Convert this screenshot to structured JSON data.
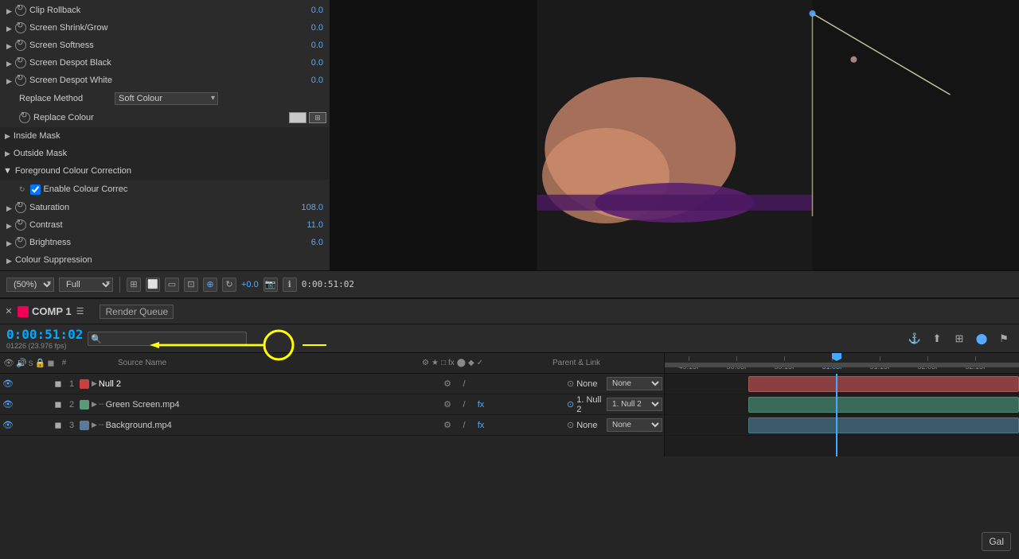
{
  "leftPanel": {
    "effects": [
      {
        "label": "Clip Rollback",
        "value": "0.0",
        "hasTriangle": true,
        "hasCycle": true
      },
      {
        "label": "Screen Shrink/Grow",
        "value": "0.0",
        "hasTriangle": true,
        "hasCycle": true
      },
      {
        "label": "Screen Softness",
        "value": "0.0",
        "hasTriangle": true,
        "hasCycle": true
      },
      {
        "label": "Screen Despot Black",
        "value": "0.0",
        "hasTriangle": true,
        "hasCycle": true
      },
      {
        "label": "Screen Despot White",
        "value": "0.0",
        "hasTriangle": true,
        "hasCycle": true
      }
    ],
    "replaceMethod": {
      "label": "Replace Method",
      "value": "Soft Colour"
    },
    "replaceColour": {
      "label": "Replace Colour"
    },
    "insideMask": "Inside Mask",
    "outsideMask": "Outside Mask",
    "foreground": {
      "label": "Foreground Colour Correction",
      "enableLabel": "Enable Colour Correc",
      "params": [
        {
          "label": "Saturation",
          "value": "108.0"
        },
        {
          "label": "Contrast",
          "value": "11.0"
        },
        {
          "label": "Brightness",
          "value": "6.0"
        }
      ],
      "colourSuppression": "Colour Suppression"
    }
  },
  "previewControls": {
    "zoom": "(50%)",
    "quality": "Full",
    "plus": "+0.0",
    "timecode": "0:00:51:02",
    "icons": [
      "grid",
      "box",
      "rect",
      "overlay",
      "color",
      "refresh",
      "camera",
      "info"
    ]
  },
  "timeline": {
    "tabs": [
      {
        "label": "COMP 1",
        "color": "#e05050"
      },
      {
        "label": "Render Queue"
      }
    ],
    "timecode": "0:00:51:02",
    "fps": "01226 (23.976 fps)",
    "searchPlaceholder": "🔍",
    "layerHeaders": {
      "icons": [
        "👁",
        "🔊",
        "S",
        "🔒",
        "◼"
      ],
      "num": "#",
      "source": "Source Name",
      "switches": [
        "⚙",
        "★",
        "□",
        "fx",
        "⬤",
        "◆",
        "✓"
      ],
      "parent": "Parent & Link"
    },
    "layers": [
      {
        "num": 1,
        "color": "#c84040",
        "hasColorBox": true,
        "name": "Null 2",
        "isNull": true,
        "visible": true,
        "switches": [
          "⚙",
          "/"
        ],
        "parentValue": "None",
        "hasParentDropdown": true
      },
      {
        "num": 2,
        "color": "#5a9a7a",
        "hasColorBox": true,
        "name": "Green Screen.mp4",
        "visible": true,
        "switches": [
          "⚙",
          "/",
          "fx"
        ],
        "parentValue": "1. Null 2",
        "hasParentDropdown": true
      },
      {
        "num": 3,
        "color": "#5a7a9a",
        "hasColorBox": true,
        "name": "Background.mp4",
        "visible": true,
        "switches": [
          "⚙",
          "/",
          "fx"
        ],
        "parentValue": "None",
        "hasParentDropdown": true
      }
    ],
    "ruler": {
      "ticks": [
        "49:15f",
        "50:03f",
        "50:15f",
        "51:03f",
        "51:15f",
        "52:03f",
        "52:15f"
      ]
    }
  },
  "galleryBtn": "Gal"
}
